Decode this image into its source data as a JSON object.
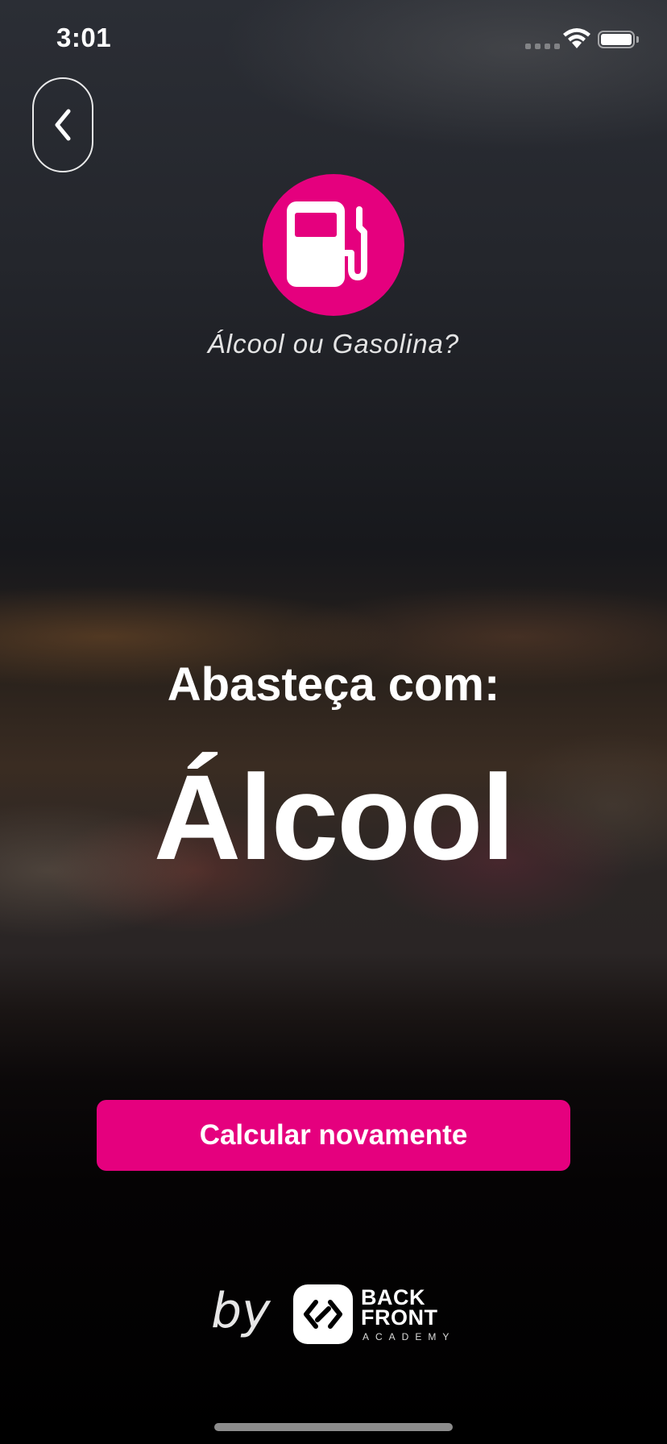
{
  "status_bar": {
    "time": "3:01"
  },
  "header": {
    "back_icon": "chevron-left-icon",
    "app_title": "Álcool ou Gasolina?",
    "logo_icon": "fuel-pump-icon"
  },
  "result": {
    "label": "Abasteça com:",
    "value": "Álcool"
  },
  "actions": {
    "recalculate_label": "Calcular novamente"
  },
  "footer": {
    "by_text": "by",
    "brand_name_line1": "BACK",
    "brand_name_line2": "FRONT",
    "brand_name_line3": "ACADEMY"
  },
  "colors": {
    "accent": "#e5007e",
    "text": "#ffffff",
    "background": "#000000"
  }
}
